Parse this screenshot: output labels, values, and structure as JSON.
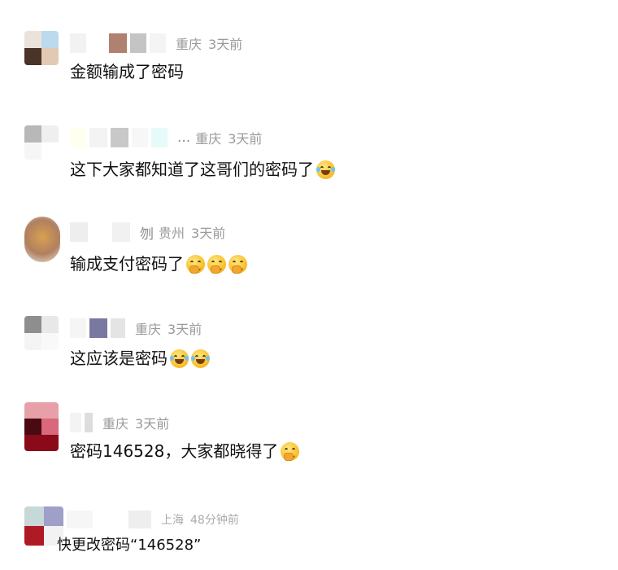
{
  "comments": [
    {
      "location": "重庆",
      "time": "3天前",
      "name_tail": "",
      "text": "金额输成了密码",
      "emojis": []
    },
    {
      "location": "重庆",
      "time": "3天前",
      "name_tail": "...",
      "text": "这下大家都知道了这哥们的密码了",
      "emojis": [
        "tears-of-joy-emoji"
      ]
    },
    {
      "location": "贵州",
      "time": "3天前",
      "name_tail": "刎",
      "text": "输成支付密码了",
      "emojis": [
        "thinking-emoji",
        "thinking-emoji",
        "thinking-emoji"
      ]
    },
    {
      "location": "重庆",
      "time": "3天前",
      "name_tail": "",
      "text": "这应该是密码",
      "emojis": [
        "tears-of-joy-emoji",
        "tears-of-joy-emoji"
      ]
    },
    {
      "location": "重庆",
      "time": "3天前",
      "name_tail": "",
      "text": "密码146528，大家都晓得了",
      "emojis": [
        "thinking-emoji"
      ]
    },
    {
      "location": "上海",
      "time": "48分钟前",
      "name_tail": "",
      "text": "快更改密码“146528”",
      "emojis": []
    }
  ],
  "colors": {
    "text": "#111111",
    "meta": "#9a9a9a",
    "background": "#ffffff"
  }
}
